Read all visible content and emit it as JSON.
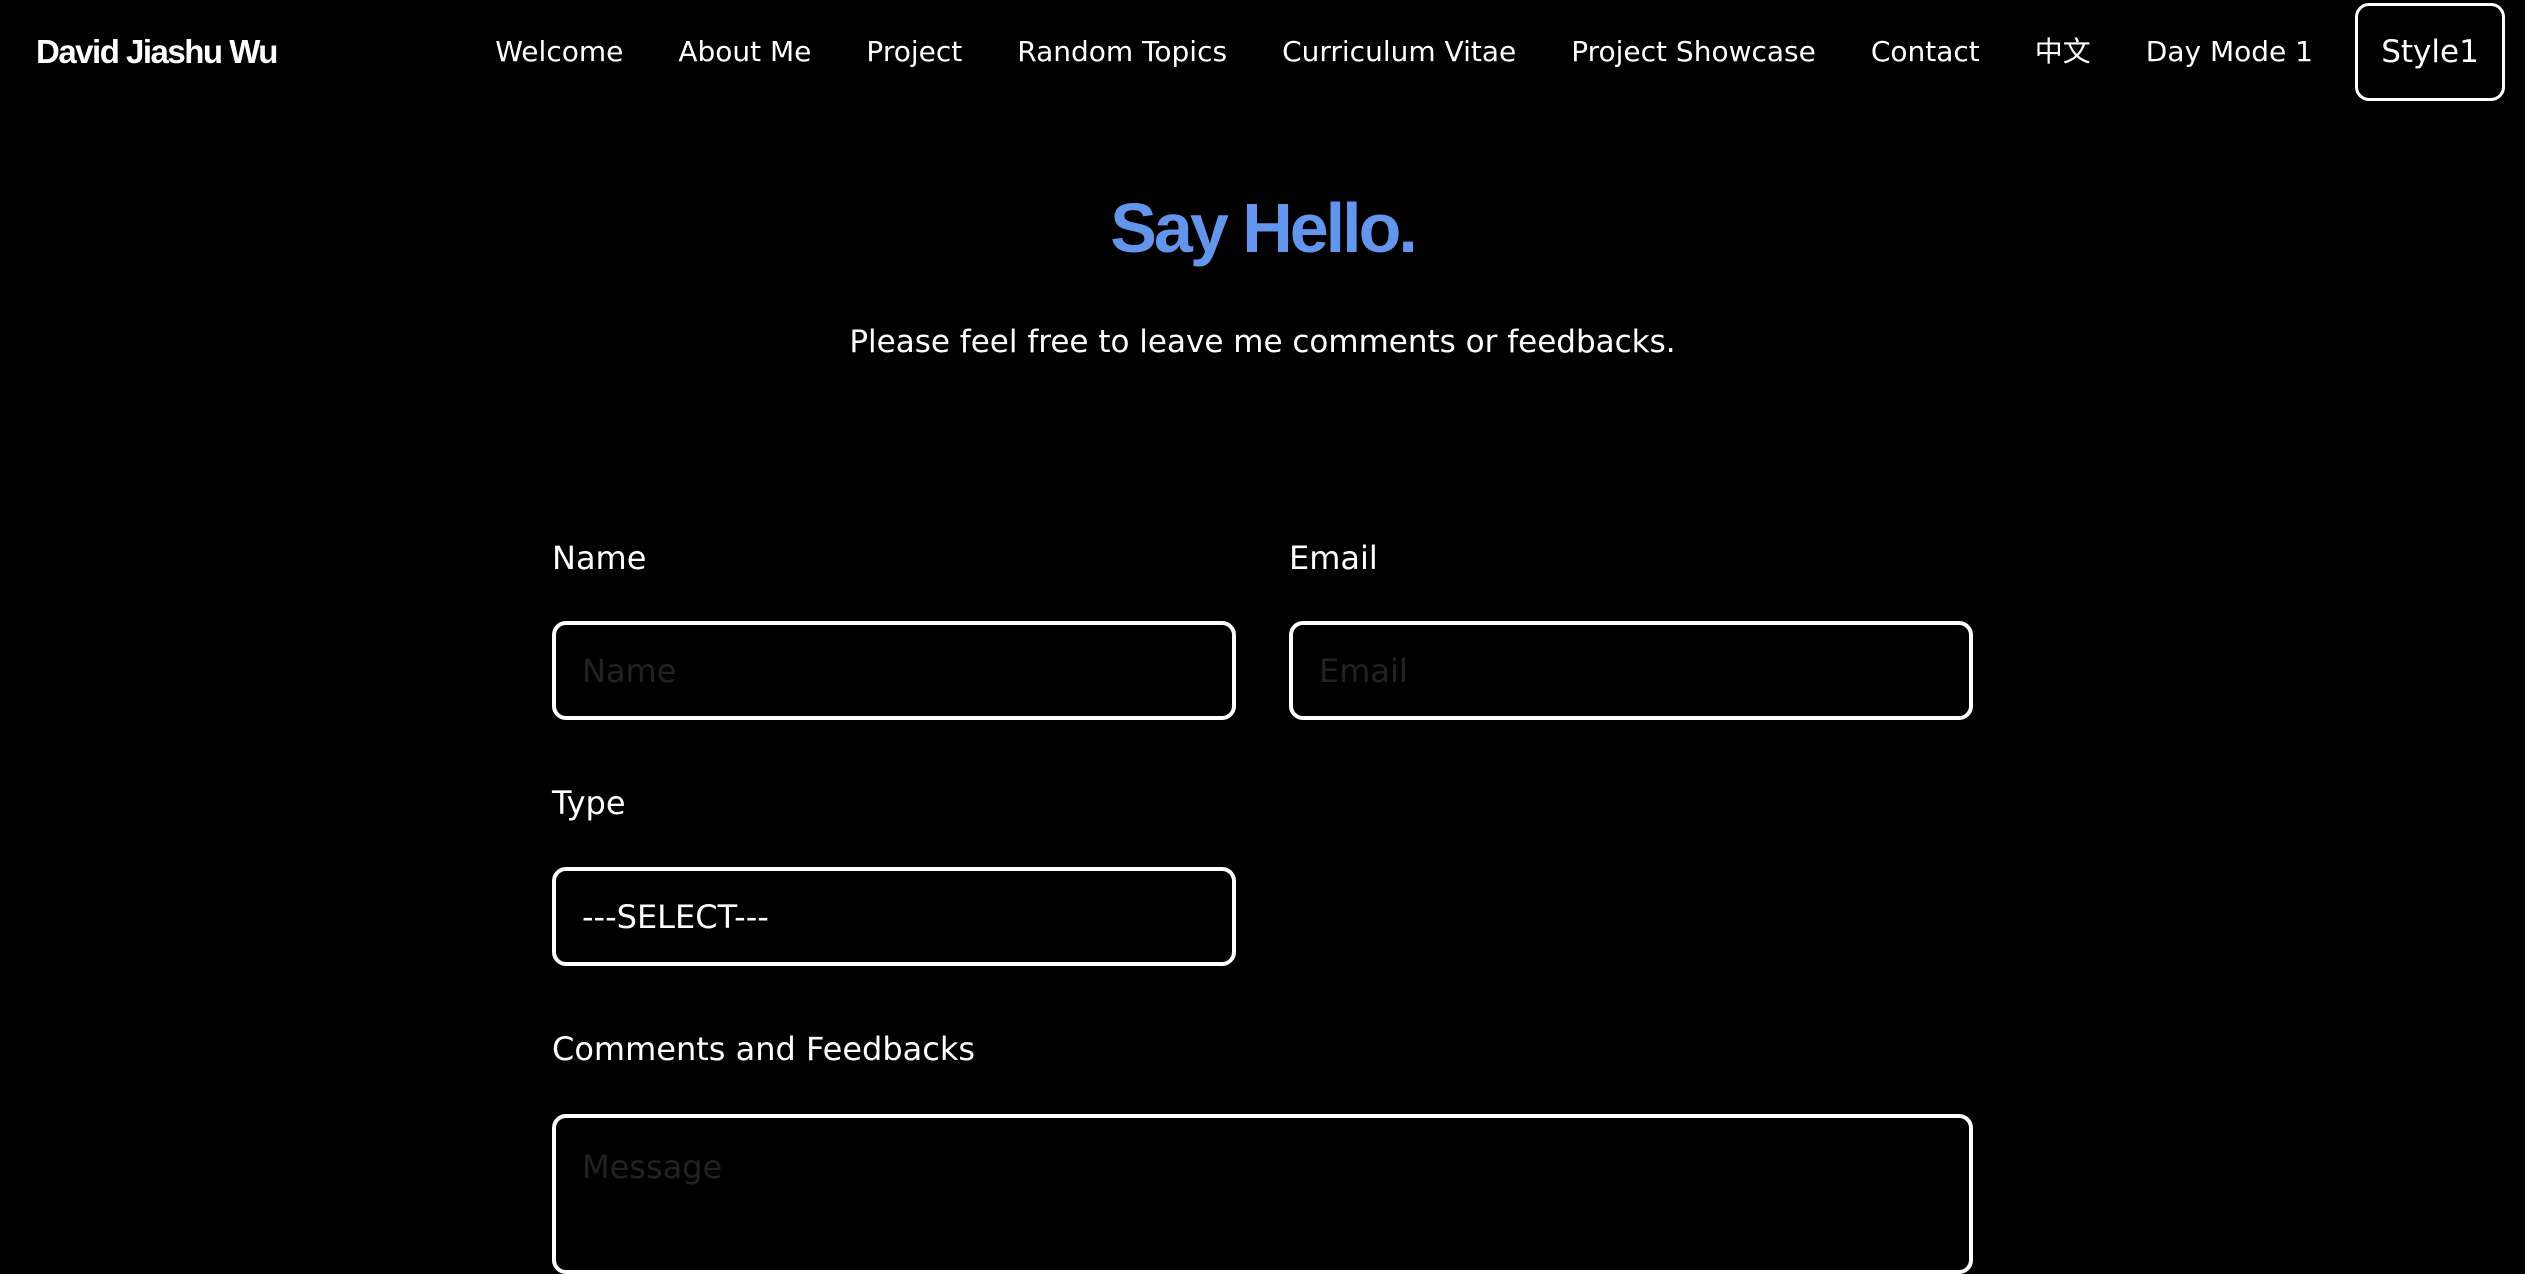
{
  "brand": "David Jiashu Wu",
  "nav": {
    "links": [
      "Welcome",
      "About Me",
      "Project",
      "Random Topics",
      "Curriculum Vitae",
      "Project Showcase",
      "Contact",
      "中文",
      "Day Mode 1"
    ],
    "style_button": "Style1"
  },
  "contact": {
    "title": "Say Hello.",
    "subtitle": "Please feel free to leave me comments or feedbacks.",
    "name": {
      "label": "Name",
      "placeholder": "Name"
    },
    "email": {
      "label": "Email",
      "placeholder": "Email"
    },
    "type": {
      "label": "Type",
      "selected": "---SELECT---"
    },
    "message": {
      "label": "Comments and Feedbacks",
      "placeholder": "Message"
    }
  },
  "colors": {
    "background": "#000000",
    "text": "#ffffff",
    "accent": "#6495ed"
  }
}
